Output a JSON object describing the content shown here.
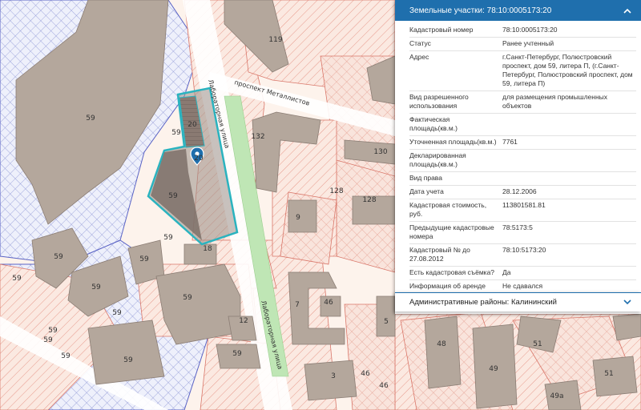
{
  "map": {
    "streets": {
      "metallistov": "проспект Металлистов",
      "laboratornaya_top": "Лабораторная улица",
      "laboratornaya_bottom": "Лабораторная улица"
    },
    "lot_numbers": [
      "119",
      "59",
      "20",
      "59",
      "20",
      "59",
      "59",
      "18",
      "59",
      "59",
      "59",
      "59",
      "59",
      "59",
      "59",
      "59",
      "59",
      "132",
      "130",
      "128",
      "128",
      "9",
      "7",
      "46",
      "12",
      "5",
      "48",
      "51",
      "49",
      "51",
      "3",
      "46",
      "46",
      "49a",
      "59",
      "59"
    ],
    "colors": {
      "selected_outline": "#2ab3bf",
      "marker": "#1f6fad",
      "green_strip": "#bfe6b5"
    }
  },
  "panel": {
    "header_title": "Земельные участки: 78:10:0005173:20",
    "collapse_icon": "chevron-up-icon",
    "rows": [
      {
        "k": "Кадастровый номер",
        "v": "78:10:0005173:20"
      },
      {
        "k": "Статус",
        "v": "Ранее учтенный"
      },
      {
        "k": "Адрес",
        "v": "г.Санкт-Петербург, Полюстровский проспект, дом 59, литера П, (г.Санкт-Петербург, Полюстровский проспект, дом 59, литера П)"
      },
      {
        "k": "Вид разрешенного использования",
        "v": "для размещения промышленных объектов"
      },
      {
        "k": "Фактическая площадь(кв.м.)",
        "v": ""
      },
      {
        "k": "Уточненная площадь(кв.м.)",
        "v": "7761"
      },
      {
        "k": "Декларированная площадь(кв.м.)",
        "v": ""
      },
      {
        "k": "Вид права",
        "v": ""
      },
      {
        "k": "Дата учета",
        "v": "28.12.2006"
      },
      {
        "k": "Кадастровая стоимость, руб.",
        "v": "113801581.81"
      },
      {
        "k": "Предыдущие кадастровые номера",
        "v": "78:5173:5"
      },
      {
        "k": "Кадастровый № до 27.08.2012",
        "v": "78:10:5173:20"
      },
      {
        "k": "Есть кадастровая съёмка?",
        "v": "Да"
      },
      {
        "k": "Информация об аренде",
        "v": "Не сдавался"
      }
    ]
  },
  "panel2": {
    "title": "Административные районы: Калининский",
    "expand_icon": "chevron-down-icon"
  }
}
